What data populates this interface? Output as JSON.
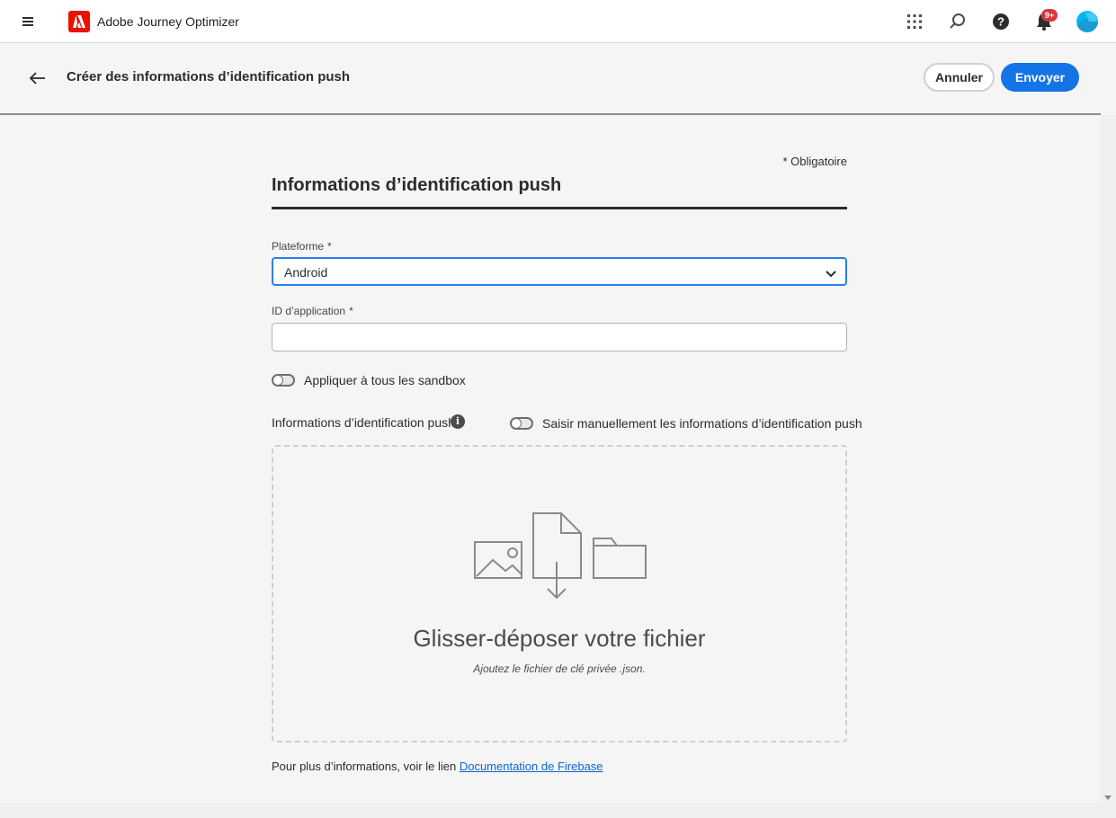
{
  "topbar": {
    "app_name": "Adobe Journey Optimizer",
    "notification_badge": "9+",
    "icons": [
      "hamburger-icon",
      "adobe-logo-icon",
      "apps-grid-icon",
      "search-icon",
      "help-icon",
      "bell-icon",
      "avatar"
    ]
  },
  "header": {
    "title": "Créer des informations d’identification push",
    "cancel_label": "Annuler",
    "send_label": "Envoyer"
  },
  "form": {
    "required_note": "* Obligatoire",
    "section_title": "Informations d’identification push",
    "platform": {
      "label": "Plateforme",
      "required_mark": "*",
      "value": "Android"
    },
    "app_id": {
      "label": "ID d’application",
      "required_mark": "*",
      "value": ""
    },
    "apply_all_sandboxes": {
      "label": "Appliquer à tous les sandbox",
      "on": false
    },
    "credentials_label": "Informations d’identification push",
    "manual_entry": {
      "label": "Saisir manuellement les informations d’identification push",
      "on": false
    },
    "dropzone": {
      "title": "Glisser-déposer votre fichier",
      "subtitle": "Ajoutez le fichier de clé privée .json."
    },
    "footer": {
      "text": "Pour plus d’informations, voir le lien ",
      "link": "Documentation de Firebase"
    }
  },
  "colors": {
    "accent": "#1473e6",
    "adobe_red": "#eb1000",
    "badge": "#d7373f"
  }
}
